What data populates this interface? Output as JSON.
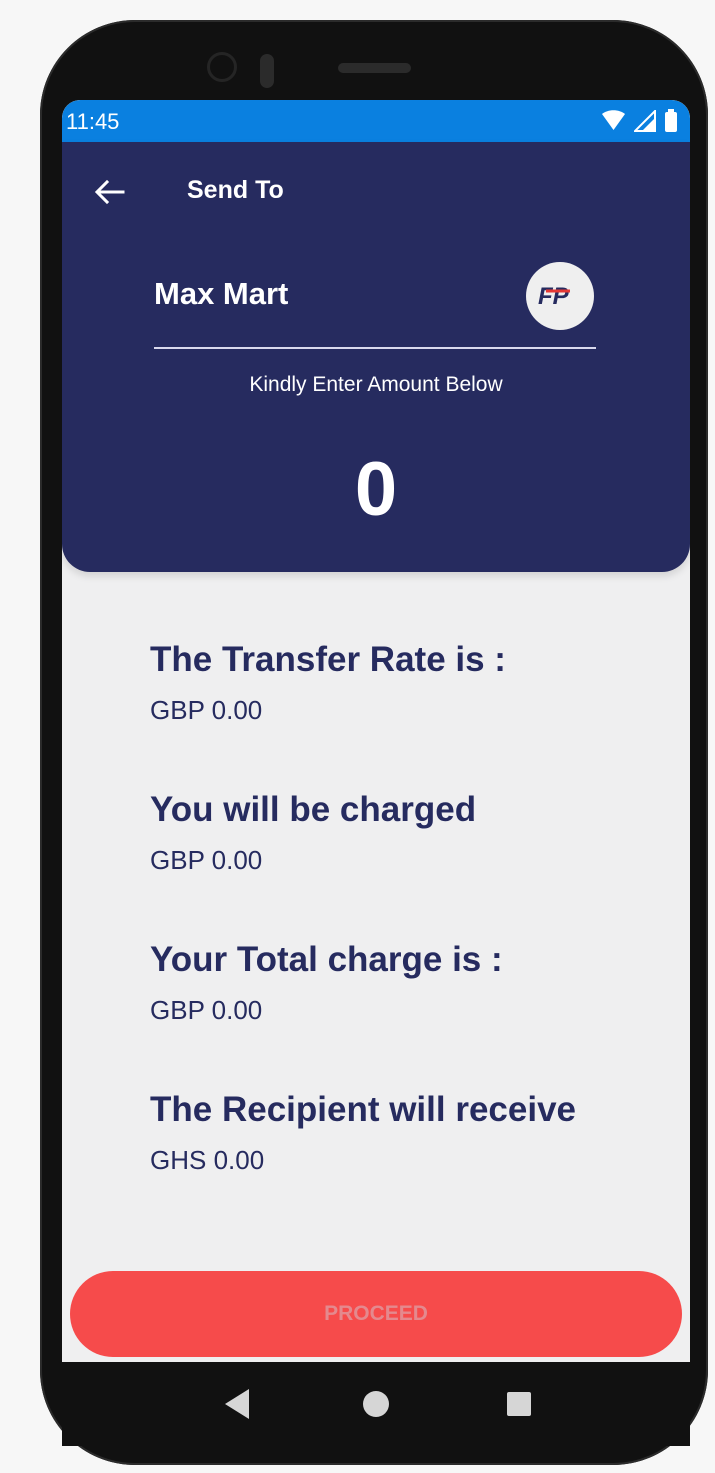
{
  "status_bar": {
    "time": "11:45",
    "icons": [
      "wifi-icon",
      "cellular-signal-icon",
      "battery-icon"
    ]
  },
  "header": {
    "title": "Send To",
    "back_icon": "arrow-left-icon",
    "merchant_name": "Max Mart",
    "merchant_logo_text": "FP",
    "instruction": "Kindly Enter Amount Below",
    "amount": "0"
  },
  "details": {
    "items": [
      {
        "label": "The Transfer Rate is :",
        "value": "GBP 0.00"
      },
      {
        "label": "You will be charged",
        "value": "GBP 0.00"
      },
      {
        "label": "Your Total charge is :",
        "value": "GBP 0.00"
      },
      {
        "label": "The Recipient will receive",
        "value": "GHS 0.00"
      }
    ]
  },
  "actions": {
    "proceed_label": "PROCEED"
  },
  "nav": {
    "icons": [
      "back-triangle-icon",
      "home-circle-icon",
      "recent-square-icon"
    ]
  },
  "colors": {
    "header_bg": "#262b5f",
    "status_bar": "#0a80e0",
    "button": "#f64b4b",
    "text_dark": "#262b5f"
  }
}
